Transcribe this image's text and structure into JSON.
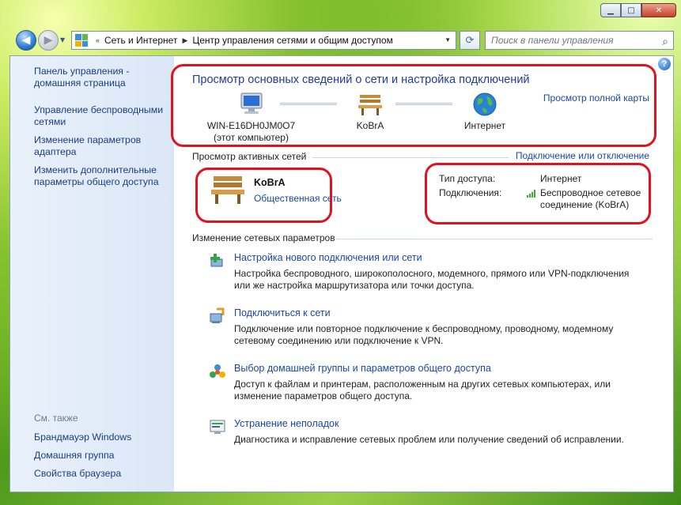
{
  "window": {
    "min_symbol": "▁",
    "max_symbol": "□",
    "close_symbol": "✕"
  },
  "nav": {
    "breadcrumb": [
      "Сеть и Интернет",
      "Центр управления сетями и общим доступом"
    ],
    "search_placeholder": "Поиск в панели управления"
  },
  "sidebar": {
    "links": [
      "Панель управления - домашняя страница",
      "Управление беспроводными сетями",
      "Изменение параметров адаптера",
      "Изменить дополнительные параметры общего доступа"
    ],
    "see_also_label": "См. также",
    "see_also": [
      "Брандмауэр Windows",
      "Домашняя группа",
      "Свойства браузера"
    ]
  },
  "main": {
    "title": "Просмотр основных сведений о сети и настройка подключений",
    "full_map_link": "Просмотр полной карты",
    "map_nodes": [
      {
        "label": "WIN-E16DH0JM0O7",
        "sub": "(этот компьютер)",
        "icon": "computer-icon"
      },
      {
        "label": "KoBrA",
        "sub": "",
        "icon": "bench-icon"
      },
      {
        "label": "Интернет",
        "sub": "",
        "icon": "globe-icon"
      }
    ],
    "active_networks_label": "Просмотр активных сетей",
    "connect_disconnect_link": "Подключение или отключение",
    "network": {
      "name": "KoBrA",
      "type": "Общественная сеть",
      "access_label": "Тип доступа:",
      "access_value": "Интернет",
      "connections_label": "Подключения:",
      "connections_value_line1": "Беспроводное сетевое",
      "connections_value_line2": "соединение (KoBrA)"
    },
    "change_settings_label": "Изменение сетевых параметров",
    "tasks": [
      {
        "title": "Настройка нового подключения или сети",
        "desc": "Настройка беспроводного, широкополосного, модемного, прямого или VPN-подключения или же настройка маршрутизатора или точки доступа.",
        "icon": "new-connection-icon"
      },
      {
        "title": "Подключиться к сети",
        "desc": "Подключение или повторное подключение к беспроводному, проводному, модемному сетевому соединению или подключение к VPN.",
        "icon": "connect-network-icon"
      },
      {
        "title": "Выбор домашней группы и параметров общего доступа",
        "desc": "Доступ к файлам и принтерам, расположенным на других сетевых компьютерах, или изменение параметров общего доступа.",
        "icon": "homegroup-icon"
      },
      {
        "title": "Устранение неполадок",
        "desc": "Диагностика и исправление сетевых проблем или получение сведений об исправлении.",
        "icon": "troubleshoot-icon"
      }
    ]
  },
  "colors": {
    "link": "#1a47a8",
    "title": "#1e3f8f",
    "annotation_red": "#e0121e"
  }
}
